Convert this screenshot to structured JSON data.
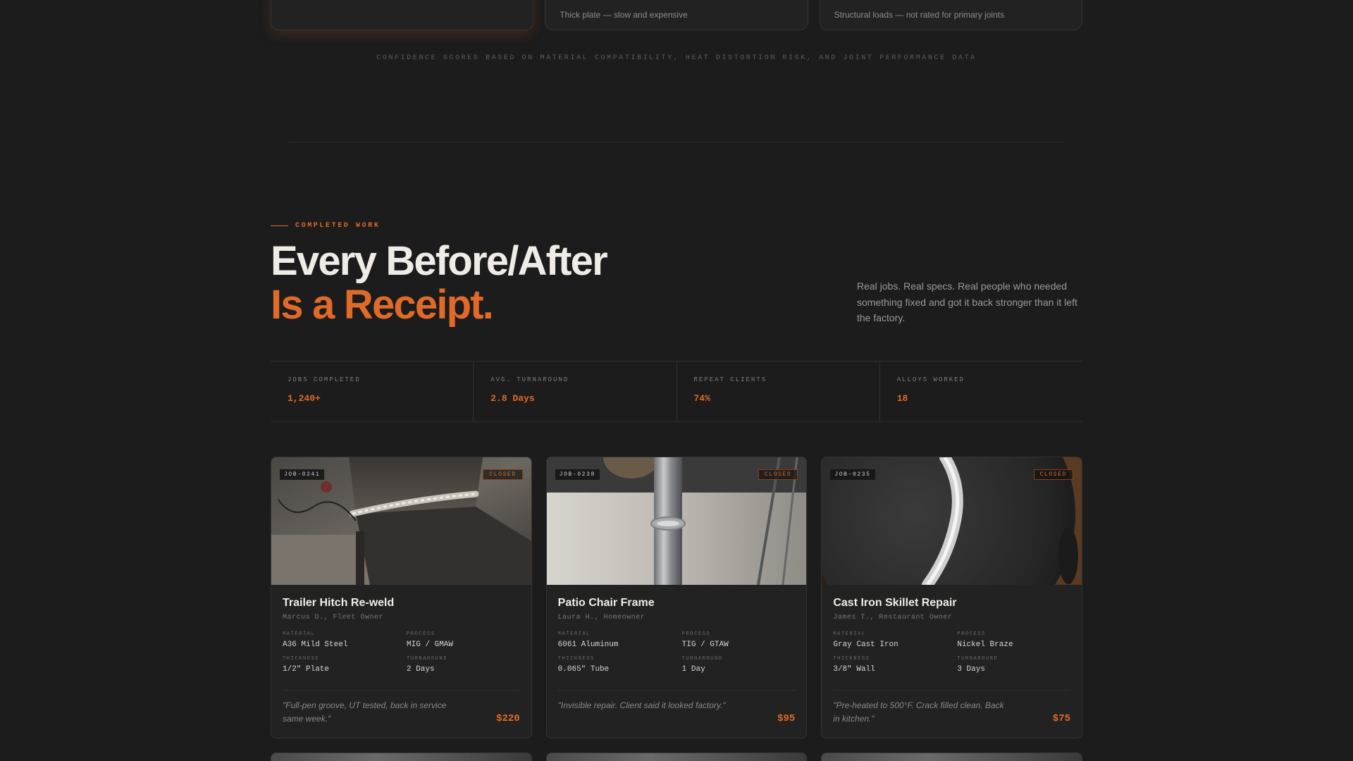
{
  "top_cards": [
    {
      "note": ""
    },
    {
      "note": "Thick plate — slow and expensive"
    },
    {
      "note": "Structural loads — not rated for primary joints"
    }
  ],
  "confidence_note": "CONFIDENCE SCORES BASED ON MATERIAL COMPATIBILITY, HEAT DISTORTION RISK, AND JOINT PERFORMANCE DATA",
  "section": {
    "eyebrow": "COMPLETED WORK",
    "headline_line1": "Every Before/After",
    "headline_line2": "Is a Receipt.",
    "blurb": "Real jobs. Real specs. Real people who needed something fixed and got it back stronger than it left the factory."
  },
  "stats": [
    {
      "label": "JOBS COMPLETED",
      "value": "1,240+"
    },
    {
      "label": "AVG. TURNAROUND",
      "value": "2.8 Days"
    },
    {
      "label": "REPEAT CLIENTS",
      "value": "74%"
    },
    {
      "label": "ALLOYS WORKED",
      "value": "18"
    }
  ],
  "spec_labels": {
    "material": "MATERIAL",
    "process": "PROCESS",
    "thickness": "THICKNESS",
    "turnaround": "TURNAROUND"
  },
  "jobs": [
    {
      "id": "JOB-0241",
      "status": "CLOSED",
      "title": "Trailer Hitch Re-weld",
      "client": "Marcus D., Fleet Owner",
      "material": "A36 Mild Steel",
      "process": "MIG / GMAW",
      "thickness": "1/2\" Plate",
      "turnaround": "2 Days",
      "quote": "\"Full-pen groove, UT tested, back in service same week.\"",
      "price": "$220"
    },
    {
      "id": "JOB-0238",
      "status": "CLOSED",
      "title": "Patio Chair Frame",
      "client": "Laura H., Homeowner",
      "material": "6061 Aluminum",
      "process": "TIG / GTAW",
      "thickness": "0.065\" Tube",
      "turnaround": "1 Day",
      "quote": "\"Invisible repair. Client said it looked factory.\"",
      "price": "$95"
    },
    {
      "id": "JOB-0235",
      "status": "CLOSED",
      "title": "Cast Iron Skillet Repair",
      "client": "James T., Restaurant Owner",
      "material": "Gray Cast Iron",
      "process": "Nickel Braze",
      "thickness": "3/8\" Wall",
      "turnaround": "3 Days",
      "quote": "\"Pre-heated to 500°F. Crack filled clean. Back in kitchen.\"",
      "price": "$75"
    }
  ],
  "colors": {
    "accent": "#e06a28",
    "background": "#1c1c1c",
    "card": "#222222"
  }
}
